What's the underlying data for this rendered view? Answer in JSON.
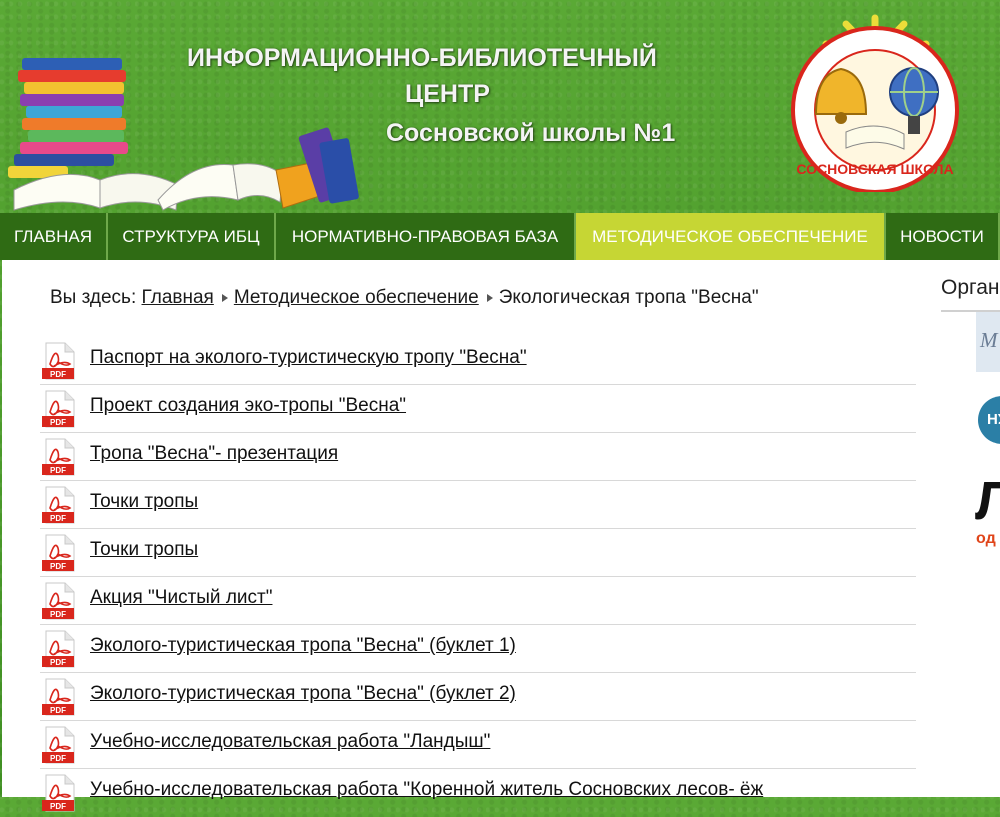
{
  "header": {
    "title_line1": "ИНФОРМАЦИОННО-БИБЛИОТЕЧНЫЙ",
    "title_line2": "ЦЕНТР",
    "title_line3": "Сосновской школы №1",
    "emblem_text": "СОСНОВСКАЯ ШКОЛА"
  },
  "nav": {
    "items": [
      {
        "label": "ГЛАВНАЯ"
      },
      {
        "label": "СТРУКТУРА ИБЦ"
      },
      {
        "label": "НОРМАТИВНО-ПРАВОВАЯ БАЗА"
      },
      {
        "label": "МЕТОДИЧЕСКОЕ ОБЕСПЕЧЕНИЕ",
        "active": true
      },
      {
        "label": "НОВОСТИ"
      }
    ]
  },
  "breadcrumb": {
    "prefix": "Вы здесь:",
    "items": [
      "Главная",
      "Методическое обеспечение"
    ],
    "current": "Экологическая тропа \"Весна\""
  },
  "documents": [
    {
      "title": "Паспорт на эколого-туристическую тропу \"Весна\"",
      "icon": "pdf-icon",
      "badge": "PDF"
    },
    {
      "title": "Проект создания эко-тропы \"Весна\"",
      "icon": "pdf-icon",
      "badge": "PDF"
    },
    {
      "title": "Тропа \"Весна\"-  презентация",
      "icon": "pdf-icon",
      "badge": "PDF"
    },
    {
      "title": "Точки тропы",
      "icon": "pdf-icon",
      "badge": "PDF"
    },
    {
      "title": " Точки тропы",
      "icon": "pdf-icon",
      "badge": "PDF"
    },
    {
      "title": "Акция \"Чистый лист\"",
      "icon": "pdf-icon",
      "badge": "PDF"
    },
    {
      "title": " Эколого-туристическая тропа \"Весна\" (буклет 1)",
      "icon": "pdf-icon",
      "badge": "PDF"
    },
    {
      "title": "Эколого-туристическая тропа \"Весна\" (буклет 2)",
      "icon": "pdf-icon",
      "badge": "PDF"
    },
    {
      "title": " Учебно-исследовательская работа \"Ландыш\"",
      "icon": "pdf-icon",
      "badge": "PDF"
    },
    {
      "title": " Учебно-исследовательская работа \"Коренной житель Сосновских лесов- ёж",
      "icon": "pdf-icon",
      "badge": "PDF"
    }
  ],
  "sidebar": {
    "title": "Орган",
    "banner_text": "М",
    "circle_text": "НУ",
    "big_text": "Л",
    "small_text": "од"
  },
  "colors": {
    "nav_bg": "#2f6b14",
    "nav_active": "#c6d634",
    "pdf_red": "#d9261c"
  }
}
